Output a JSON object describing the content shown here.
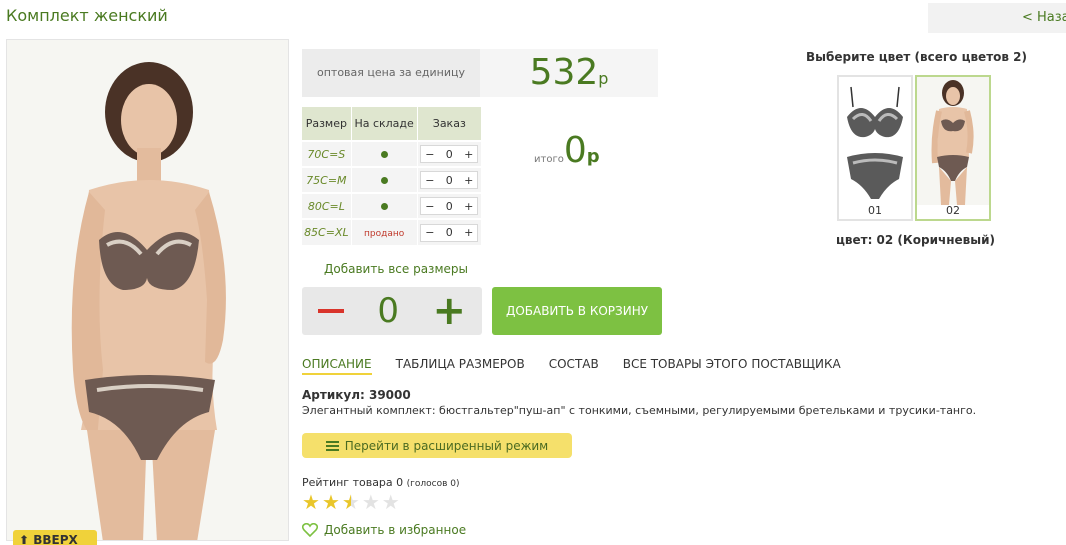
{
  "product": {
    "title": "Комплект женский",
    "back_label": "< Назад",
    "up_label": "⬆ ВВЕРХ"
  },
  "price": {
    "label": "оптовая цена за единицу",
    "value": "532",
    "currency": "р"
  },
  "sizes_table": {
    "headers": [
      "Размер",
      "На складе",
      "Заказ"
    ],
    "rows": [
      {
        "size": "70C=S",
        "in_stock": true,
        "stock_text": "",
        "qty": "0"
      },
      {
        "size": "75C=M",
        "in_stock": true,
        "stock_text": "",
        "qty": "0"
      },
      {
        "size": "80C=L",
        "in_stock": true,
        "stock_text": "",
        "qty": "0"
      },
      {
        "size": "85C=XL",
        "in_stock": false,
        "stock_text": "продано",
        "qty": "0"
      }
    ],
    "minus": "−",
    "plus": "+"
  },
  "total": {
    "label": "итого",
    "value": "0",
    "currency": "р"
  },
  "add_all_sizes": "Добавить все размеры",
  "quantity": {
    "value": "0",
    "plus": "+"
  },
  "add_to_cart": "ДОБАВИТЬ В КОРЗИНУ",
  "tabs": [
    {
      "label": "ОПИСАНИЕ",
      "active": true
    },
    {
      "label": "ТАБЛИЦА РАЗМЕРОВ",
      "active": false
    },
    {
      "label": "СОСТАВ",
      "active": false
    },
    {
      "label": "ВСЕ ТОВАРЫ ЭТОГО ПОСТАВЩИКА",
      "active": false
    }
  ],
  "article": "Артикул: 39000",
  "description": "Элегантный комплект: бюстгальтер\"пуш-ап\" с тонкими, съемными, регулируемыми бретельками и трусики-танго.",
  "extended_mode": "Перейти в расширенный режим",
  "rating": {
    "label": "Рейтинг товара 0",
    "votes": "(голосов 0)",
    "value": 2.5,
    "max": 5
  },
  "favorite": "Добавить в избранное",
  "colors": {
    "title": "Выберите цвет (всего цветов 2)",
    "options": [
      {
        "code": "01",
        "selected": false
      },
      {
        "code": "02",
        "selected": true
      }
    ],
    "current": "цвет: 02 (Коричневый)"
  },
  "palette": {
    "brand_green": "#4a7a21",
    "button_green": "#7dc142",
    "yellow": "#f0d23a",
    "red": "#d9342b"
  }
}
